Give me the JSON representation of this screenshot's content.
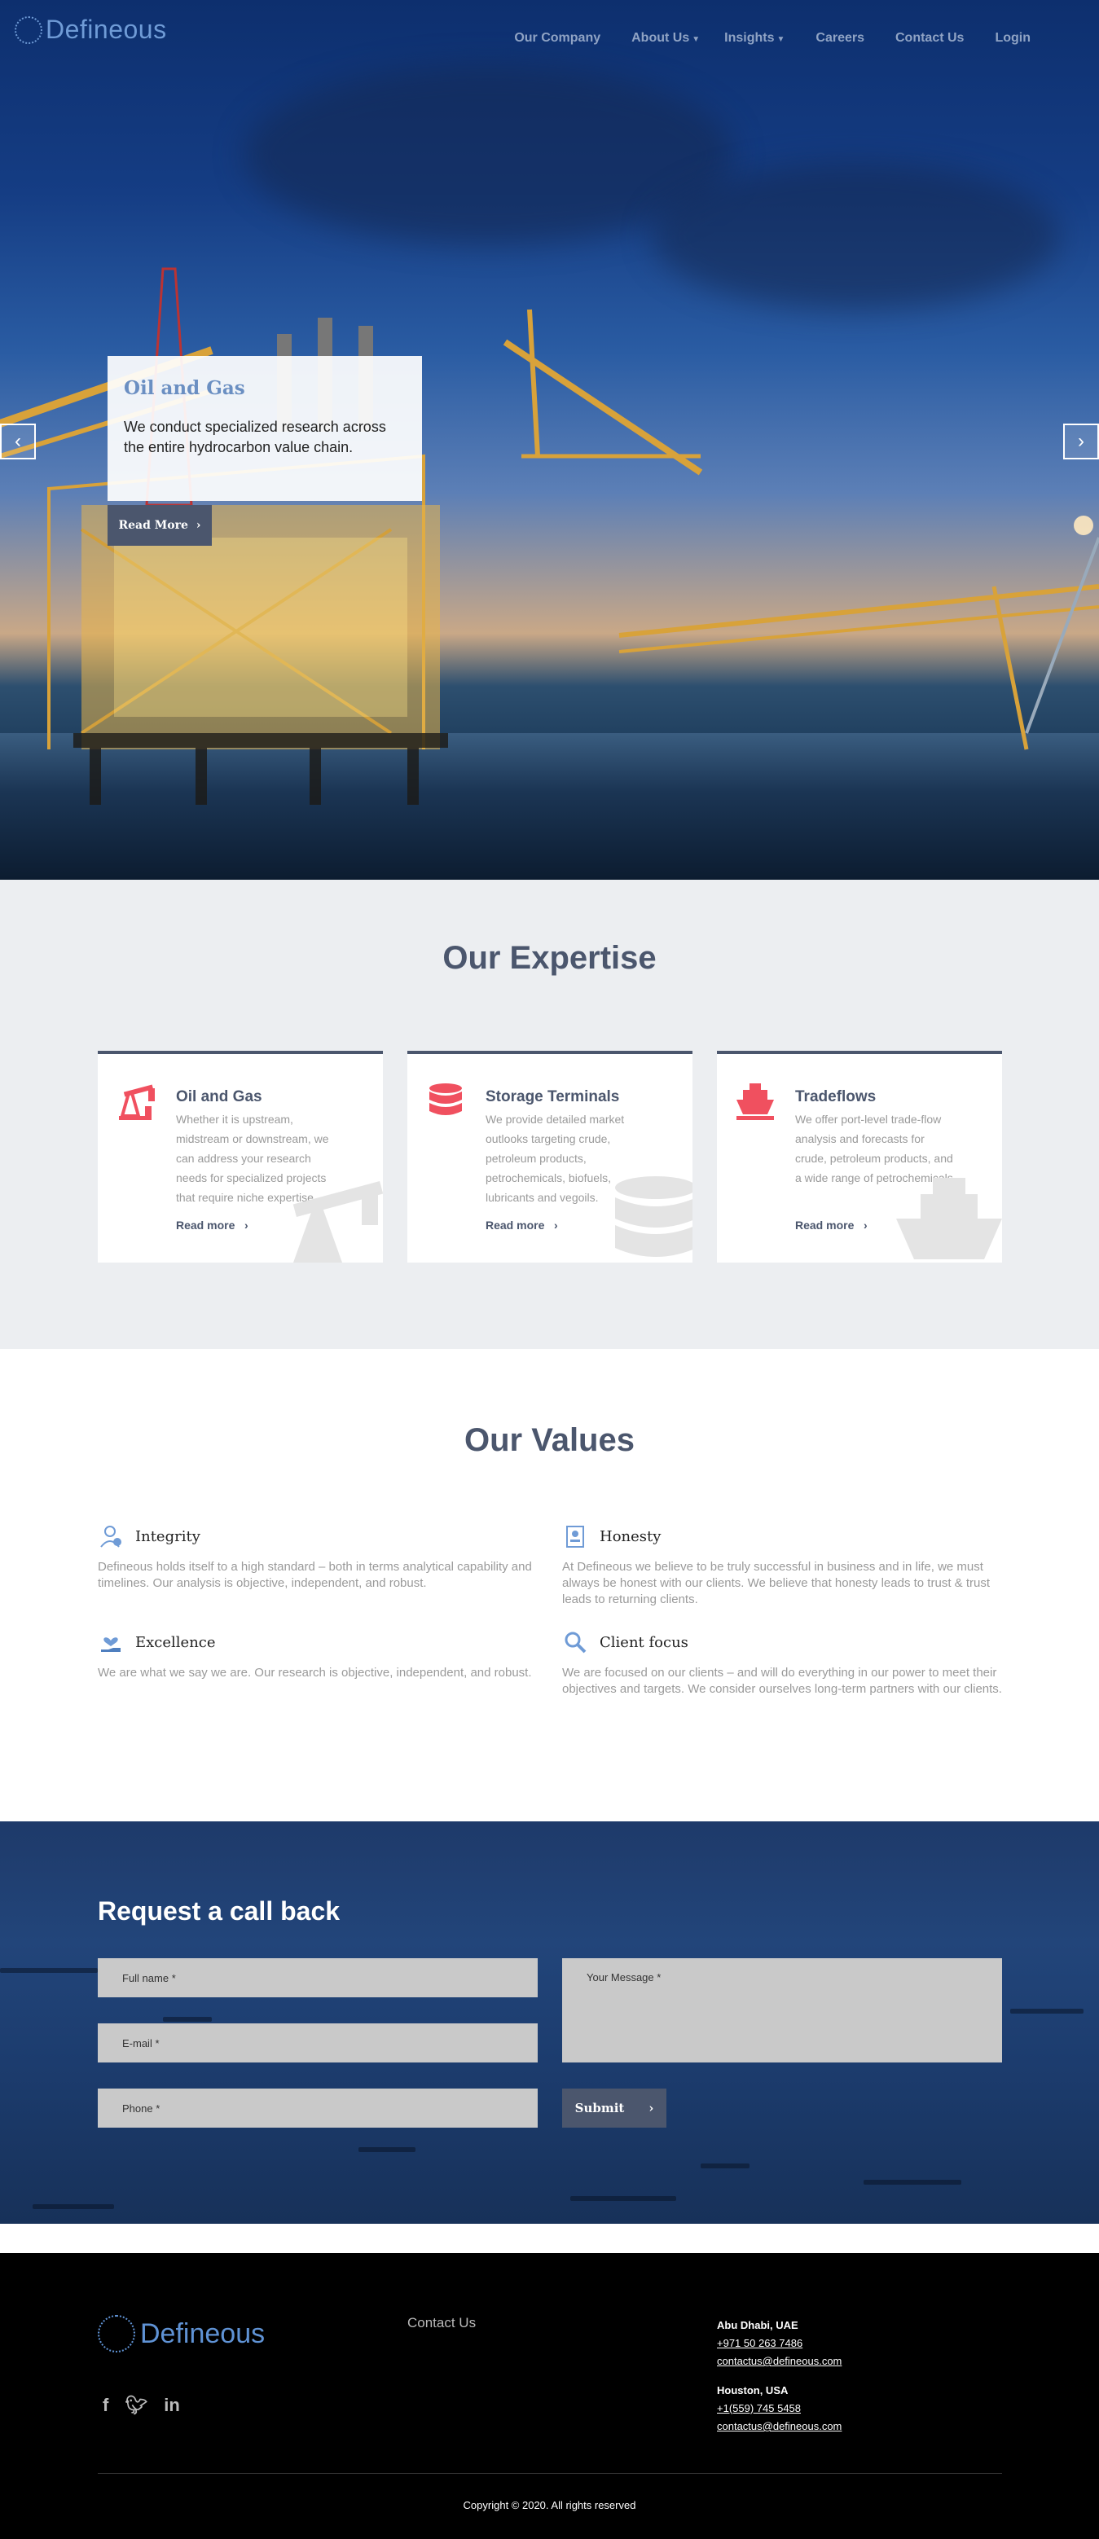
{
  "brand": {
    "name": "Defineous"
  },
  "nav": {
    "items": [
      {
        "label": "Our Company",
        "caret": false
      },
      {
        "label": "About Us",
        "caret": true
      },
      {
        "label": "Insights",
        "caret": true
      },
      {
        "label": "Careers",
        "caret": false
      },
      {
        "label": "Contact Us",
        "caret": false
      },
      {
        "label": "Login",
        "caret": false
      }
    ]
  },
  "hero": {
    "title": "Oil and Gas",
    "text": "We conduct specialized research across the entire hydrocarbon value chain.",
    "button": "Read More"
  },
  "expertise": {
    "title": "Our Expertise",
    "cards": [
      {
        "icon": "oil-pump-icon",
        "title": "Oil and Gas",
        "desc": "Whether it is upstream, midstream or downstream, we can address your research needs for specialized projects that require niche expertise.",
        "more": "Read more"
      },
      {
        "icon": "database-icon",
        "title": "Storage Terminals",
        "desc": "We provide detailed market outlooks targeting crude, petroleum products, petrochemicals, biofuels, lubricants and vegoils.",
        "more": "Read more"
      },
      {
        "icon": "ship-icon",
        "title": "Tradeflows",
        "desc": "We offer port-level trade-flow analysis and forecasts for crude, petroleum products, and a wide range of petrochemicals.",
        "more": "Read more"
      }
    ]
  },
  "values": {
    "title": "Our Values",
    "items": [
      {
        "icon": "user-check-icon",
        "title": "Integrity",
        "desc": "Defineous holds itself to a high standard – both in terms analytical capability and timelines. Our analysis is objective, independent, and robust."
      },
      {
        "icon": "id-badge-icon",
        "title": "Honesty",
        "desc": "At Defineous we believe to be truly successful in business and in life, we must always be honest with our clients. We believe that honesty leads to trust & trust leads to returning clients."
      },
      {
        "icon": "hand-heart-icon",
        "title": "Excellence",
        "desc": "We are what we say we are. Our research is objective, independent, and robust."
      },
      {
        "icon": "search-icon",
        "title": "Client focus",
        "desc": "We are focused on our clients – and will do everything in our power to meet their objectives and targets. We consider ourselves long-term partners with our clients."
      }
    ]
  },
  "callback": {
    "title": "Request a call back",
    "fullname": "Full name *",
    "email": "E-mail *",
    "phone": "Phone *",
    "message": "Your Message *",
    "submit": "Submit"
  },
  "footer": {
    "contact_link": "Contact Us",
    "social": [
      "facebook-icon",
      "twitter-icon",
      "linkedin-icon"
    ],
    "offices": [
      {
        "city": "Abu Dhabi, UAE",
        "phone": "+971 50 263 7486",
        "email": "contactus@defineous.com"
      },
      {
        "city": "Houston, USA",
        "phone": "+1(559) 745 5458",
        "email": "contactus@defineous.com"
      }
    ],
    "copyright": "Copyright © 2020. All rights reserved"
  },
  "colors": {
    "accent": "#4b566d",
    "brand_blue": "#6f9bd6",
    "icon_red": "#f0505f"
  }
}
